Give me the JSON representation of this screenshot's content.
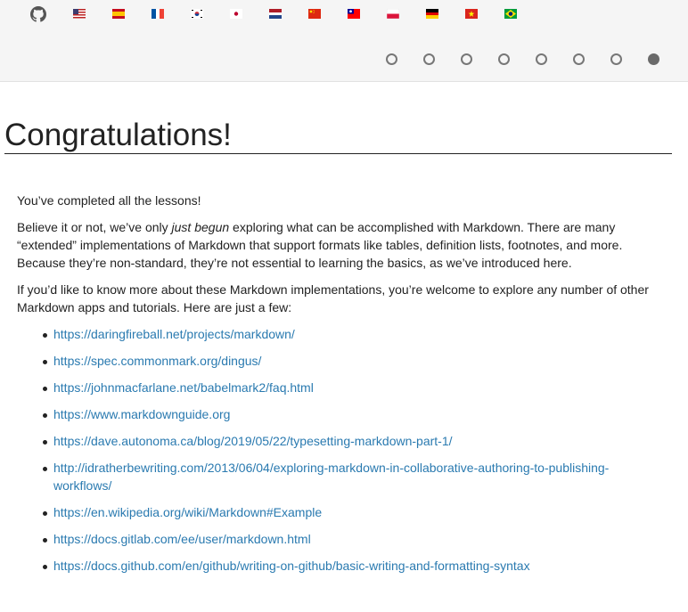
{
  "header": {
    "flags": [
      {
        "name": "us-flag-icon"
      },
      {
        "name": "spain-flag-icon"
      },
      {
        "name": "france-flag-icon"
      },
      {
        "name": "korea-flag-icon"
      },
      {
        "name": "japan-flag-icon"
      },
      {
        "name": "netherlands-flag-icon"
      },
      {
        "name": "china-flag-icon"
      },
      {
        "name": "taiwan-flag-icon"
      },
      {
        "name": "poland-flag-icon"
      },
      {
        "name": "germany-flag-icon"
      },
      {
        "name": "vietnam-flag-icon"
      },
      {
        "name": "brazil-flag-icon"
      }
    ],
    "progress": {
      "total": 8,
      "current": 8
    }
  },
  "main": {
    "title": "Congratulations!",
    "p1": "You’ve completed all the lessons!",
    "p2_before": "Believe it or not, we’ve only ",
    "p2_em": "just begun",
    "p2_after": " exploring what can be accomplished with Markdown. There are many “extended” implementations of Markdown that support formats like tables, definition lists, footnotes, and more. Because they’re non-standard, they’re not essential to learning the basics, as we’ve introduced here.",
    "p3": "If you’d like to know more about these Markdown implementations, you’re welcome to explore any number of other Markdown apps and tutorials. Here are just a few:",
    "links": [
      "https://daringfireball.net/projects/markdown/",
      "https://spec.commonmark.org/dingus/",
      "https://johnmacfarlane.net/babelmark2/faq.html",
      "https://www.markdownguide.org",
      "https://dave.autonoma.ca/blog/2019/05/22/typesetting-markdown-part-1/",
      "http://idratherbewriting.com/2013/06/04/exploring-markdown-in-collaborative-authoring-to-publishing-workflows/",
      "https://en.wikipedia.org/wiki/Markdown#Example",
      "https://docs.gitlab.com/ee/user/markdown.html",
      "https://docs.github.com/en/github/writing-on-github/basic-writing-and-formatting-syntax"
    ]
  },
  "colors": {
    "link": "#2a7ab0",
    "active_dot": "#6a6a6a",
    "bar": "#f5f5f5"
  }
}
